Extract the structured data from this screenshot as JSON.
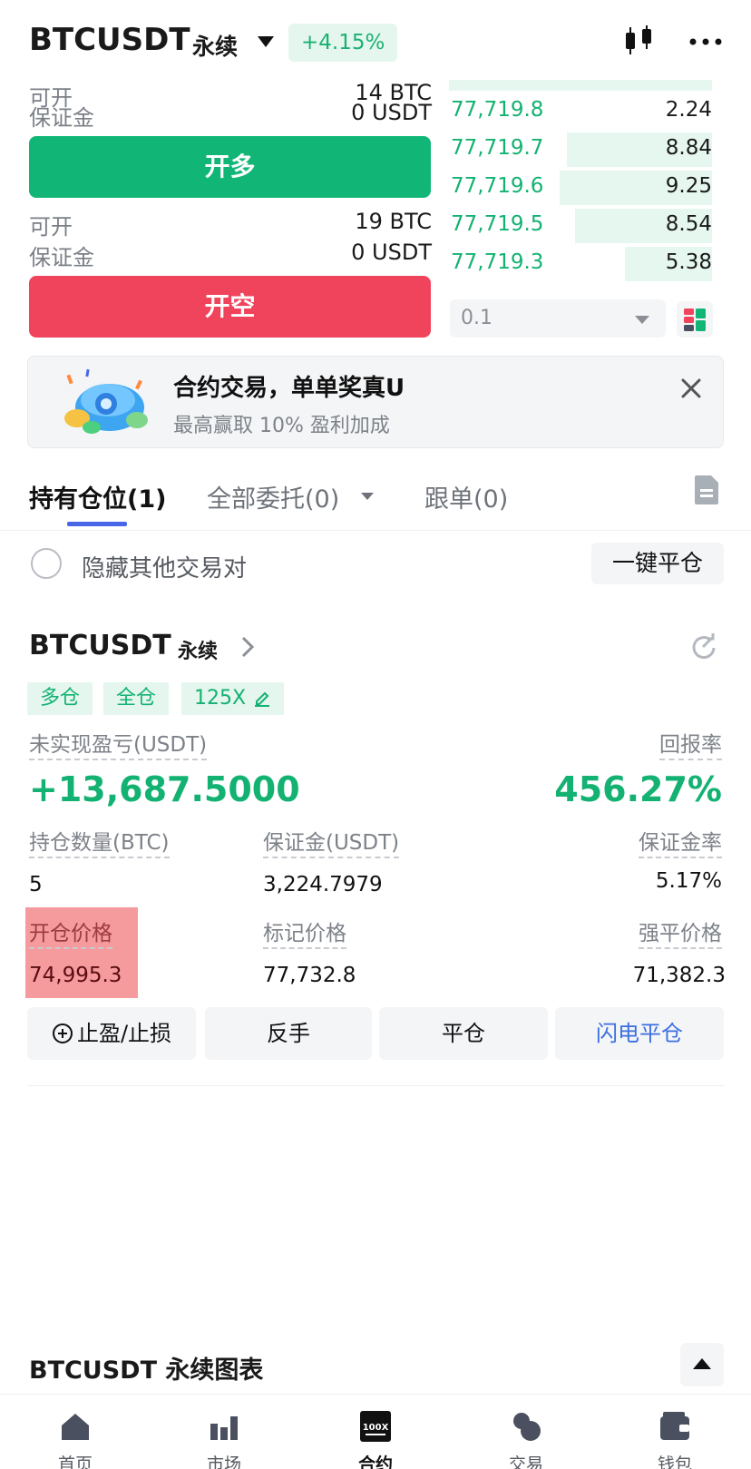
{
  "header": {
    "pair": "BTCUSDT",
    "contract_type": "永续",
    "change": "+4.15%"
  },
  "order_form": {
    "long_info": {
      "open_label": "可开",
      "open_value": "14 BTC",
      "margin_label": "保证金",
      "margin_value": "0 USDT"
    },
    "long_button": "开多",
    "short_info": {
      "open_label": "可开",
      "open_value": "19 BTC",
      "margin_label": "保证金",
      "margin_value": "0 USDT"
    },
    "short_button": "开空"
  },
  "order_book": {
    "rows": [
      {
        "price": "77,719.8",
        "qty": "2.24",
        "depth": 0.0
      },
      {
        "price": "77,719.7",
        "qty": "8.84",
        "depth": 0.55
      },
      {
        "price": "77,719.6",
        "qty": "9.25",
        "depth": 0.58
      },
      {
        "price": "77,719.5",
        "qty": "8.54",
        "depth": 0.52
      },
      {
        "price": "77,719.3",
        "qty": "5.38",
        "depth": 0.33
      }
    ],
    "precision": "0.1"
  },
  "banner": {
    "title": "合约交易，单单奖真U",
    "subtitle": "最高赢取 10% 盈利加成"
  },
  "tabs": [
    {
      "label": "持有仓位(1)"
    },
    {
      "label": "全部委托(0)"
    },
    {
      "label": "跟单(0)"
    }
  ],
  "filters": {
    "hide_label": "隐藏其他交易对",
    "close_all": "一键平仓"
  },
  "position": {
    "pair": "BTCUSDT",
    "contract_type": "永续",
    "tags": {
      "side": "多仓",
      "margin_mode": "全仓",
      "leverage": "125X"
    },
    "unrealized_label": "未实现盈亏(USDT)",
    "unrealized_value": "+13,687.5000",
    "roe_label": "回报率",
    "roe_value": "456.27%",
    "size_label": "持仓数量(BTC)",
    "size_value": "5",
    "margin_label": "保证金(USDT)",
    "margin_value": "3,224.7979",
    "margin_ratio_label": "保证金率",
    "margin_ratio_value": "5.17%",
    "entry_label": "开仓价格",
    "entry_value": "74,995.3",
    "mark_label": "标记价格",
    "mark_value": "77,732.8",
    "liq_label": "强平价格",
    "liq_value": "71,382.3",
    "actions": {
      "tpsl": "止盈/止损",
      "reverse": "反手",
      "close": "平仓",
      "flash_close": "闪电平仓"
    }
  },
  "chart_bar": {
    "title": "BTCUSDT 永续图表"
  },
  "nav": [
    {
      "label": "首页",
      "icon": "home-icon"
    },
    {
      "label": "市场",
      "icon": "market-icon"
    },
    {
      "label": "合约",
      "icon": "futures-icon"
    },
    {
      "label": "交易",
      "icon": "trade-icon"
    },
    {
      "label": "钱包",
      "icon": "wallet-icon"
    }
  ],
  "colors": {
    "green": "#11b676",
    "red": "#f0445c",
    "accent_blue": "#4a66e8"
  }
}
